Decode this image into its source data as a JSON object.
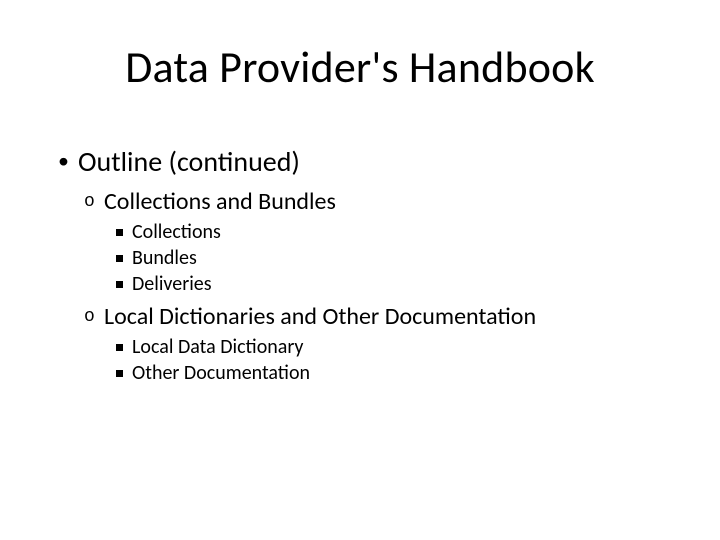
{
  "title": "Data Provider's Handbook",
  "outline": {
    "heading": "Outline (continued)",
    "sections": [
      {
        "label": "Collections and Bundles",
        "items": [
          "Collections",
          "Bundles",
          "Deliveries"
        ]
      },
      {
        "label": "Local Dictionaries and Other Documentation",
        "items": [
          "Local Data Dictionary",
          "Other Documentation"
        ]
      }
    ]
  }
}
